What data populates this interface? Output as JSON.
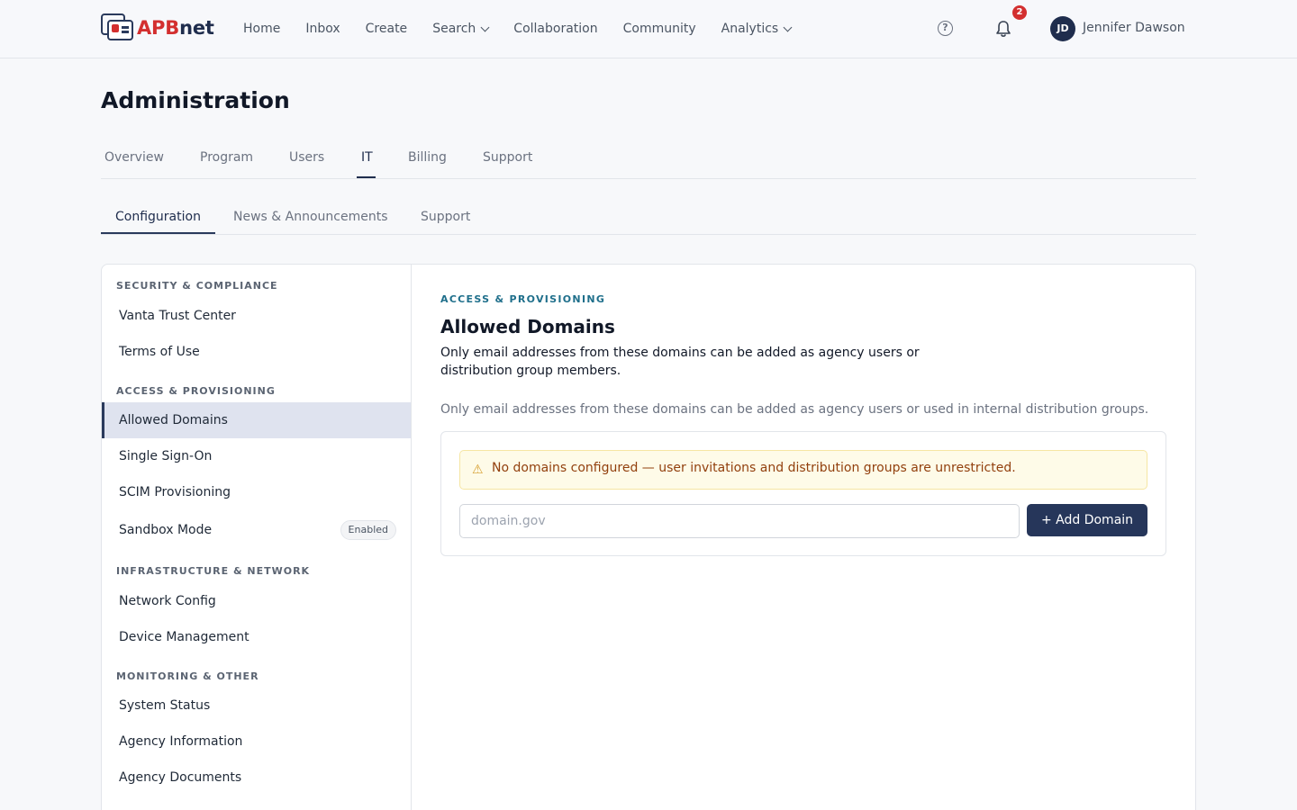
{
  "brand": {
    "part1": "APB",
    "part2": "net"
  },
  "nav": {
    "items": [
      {
        "label": "Home"
      },
      {
        "label": "Inbox"
      },
      {
        "label": "Create"
      },
      {
        "label": "Search",
        "dropdown": true
      },
      {
        "label": "Collaboration"
      },
      {
        "label": "Community"
      },
      {
        "label": "Analytics",
        "dropdown": true
      }
    ]
  },
  "header": {
    "help_glyph": "?",
    "notification_count": "2",
    "user_initials": "JD",
    "user_name": "Jennifer Dawson"
  },
  "page": {
    "title": "Administration"
  },
  "main_tabs": [
    {
      "label": "Overview"
    },
    {
      "label": "Program"
    },
    {
      "label": "Users"
    },
    {
      "label": "IT",
      "active": true
    },
    {
      "label": "Billing"
    },
    {
      "label": "Support"
    }
  ],
  "sub_tabs": [
    {
      "label": "Configuration",
      "active": true
    },
    {
      "label": "News & Announcements"
    },
    {
      "label": "Support"
    }
  ],
  "sidebar": {
    "groups": [
      {
        "heading": "SECURITY & COMPLIANCE",
        "items": [
          {
            "label": "Vanta Trust Center"
          },
          {
            "label": "Terms of Use"
          }
        ]
      },
      {
        "heading": "ACCESS & PROVISIONING",
        "items": [
          {
            "label": "Allowed Domains",
            "active": true
          },
          {
            "label": "Single Sign-On"
          },
          {
            "label": "SCIM Provisioning"
          },
          {
            "label": "Sandbox Mode",
            "badge": "Enabled"
          }
        ]
      },
      {
        "heading": "INFRASTRUCTURE & NETWORK",
        "items": [
          {
            "label": "Network Config"
          },
          {
            "label": "Device Management"
          }
        ]
      },
      {
        "heading": "MONITORING & OTHER",
        "items": [
          {
            "label": "System Status"
          },
          {
            "label": "Agency Information"
          },
          {
            "label": "Agency Documents"
          }
        ]
      }
    ]
  },
  "content": {
    "eyebrow": "ACCESS & PROVISIONING",
    "title": "Allowed Domains",
    "description": "Only email addresses from these domains can be added as agency users or distribution group members.",
    "note": "Only email addresses from these domains can be added as agency users or used in internal distribution groups.",
    "warning_icon": "⚠",
    "warning": "No domains configured — user invitations and distribution groups are unrestricted.",
    "input_value": "",
    "input_placeholder": "domain.gov",
    "add_button": "+ Add Domain"
  },
  "colors": {
    "brand_red": "#d32f2f",
    "brand_navy": "#1f2d4d",
    "eyebrow_teal": "#1f6f8b",
    "warning_bg": "#fefbe8",
    "warning_text": "#92400e"
  }
}
